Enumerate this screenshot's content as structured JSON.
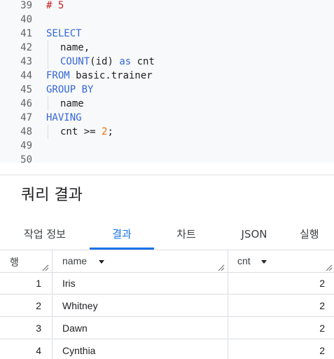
{
  "editor": {
    "lines": [
      {
        "no": "39",
        "tokens": [
          {
            "t": "# 5",
            "c": "comment"
          }
        ]
      },
      {
        "no": "40",
        "tokens": []
      },
      {
        "no": "41",
        "tokens": [
          {
            "t": "SELECT",
            "c": "kw"
          }
        ]
      },
      {
        "no": "42",
        "indent": true,
        "tokens": [
          {
            "t": "name,",
            "c": "plain"
          }
        ]
      },
      {
        "no": "43",
        "indent": true,
        "tokens": [
          {
            "t": "COUNT",
            "c": "fn"
          },
          {
            "t": "(id) ",
            "c": "plain"
          },
          {
            "t": "as",
            "c": "kw"
          },
          {
            "t": " cnt",
            "c": "plain"
          }
        ]
      },
      {
        "no": "44",
        "tokens": [
          {
            "t": "FROM",
            "c": "kw"
          },
          {
            "t": " basic.trainer",
            "c": "plain"
          }
        ]
      },
      {
        "no": "45",
        "tokens": [
          {
            "t": "GROUP BY",
            "c": "kw"
          }
        ]
      },
      {
        "no": "46",
        "indent": true,
        "tokens": [
          {
            "t": "name",
            "c": "plain"
          }
        ]
      },
      {
        "no": "47",
        "tokens": [
          {
            "t": "HAVING",
            "c": "kw"
          }
        ]
      },
      {
        "no": "48",
        "indent": true,
        "tokens": [
          {
            "t": "cnt >= ",
            "c": "plain"
          },
          {
            "t": "2",
            "c": "num"
          },
          {
            "t": ";",
            "c": "plain"
          }
        ]
      },
      {
        "no": "49",
        "tokens": []
      },
      {
        "no": "50",
        "tokens": []
      }
    ]
  },
  "results": {
    "title": "쿼리 결과",
    "tabs": [
      {
        "label": "작업 정보",
        "active": false
      },
      {
        "label": "결과",
        "active": true
      },
      {
        "label": "차트",
        "active": false
      },
      {
        "label": "JSON",
        "active": false
      },
      {
        "label": "실행",
        "active": false
      }
    ],
    "columns": {
      "row": "행",
      "name": "name",
      "cnt": "cnt"
    },
    "rows": [
      {
        "row": "1",
        "name": "Iris",
        "cnt": "2"
      },
      {
        "row": "2",
        "name": "Whitney",
        "cnt": "2"
      },
      {
        "row": "3",
        "name": "Dawn",
        "cnt": "2"
      },
      {
        "row": "4",
        "name": "Cynthia",
        "cnt": "2"
      }
    ]
  },
  "colors": {
    "accent": "#1a73e8",
    "keyword": "#3367d6",
    "number": "#e8710a",
    "comment": "#c5221f"
  }
}
